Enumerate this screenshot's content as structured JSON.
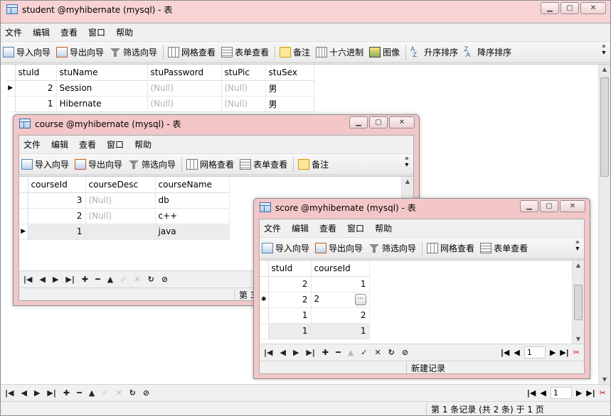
{
  "main": {
    "title": "student @myhibernate (mysql) - 表",
    "menu": [
      "文件",
      "编辑",
      "查看",
      "窗口",
      "帮助"
    ],
    "toolbar": [
      "导入向导",
      "导出向导",
      "筛选向导",
      "网格查看",
      "表单查看",
      "备注",
      "十六进制",
      "图像",
      "升序排序",
      "降序排序"
    ],
    "columns": [
      "stuId",
      "stuName",
      "stuPassword",
      "stuPic",
      "stuSex"
    ],
    "rows": [
      [
        "2",
        "Session",
        "(Null)",
        "(Null)",
        "男"
      ],
      [
        "1",
        "Hibernate",
        "(Null)",
        "(Null)",
        "男"
      ]
    ],
    "page": "1",
    "status": "第 1 条记录 (共 2 条) 于 1 页"
  },
  "course": {
    "title": "course @myhibernate (mysql) - 表",
    "menu": [
      "文件",
      "编辑",
      "查看",
      "窗口",
      "帮助"
    ],
    "toolbar": [
      "导入向导",
      "导出向导",
      "筛选向导",
      "网格查看",
      "表单查看",
      "备注"
    ],
    "columns": [
      "courseId",
      "courseDesc",
      "courseName"
    ],
    "rows": [
      [
        "3",
        "(Null)",
        "db"
      ],
      [
        "2",
        "(Null)",
        "c++"
      ],
      [
        "1",
        "",
        "java"
      ]
    ],
    "status_fragment": "第 3"
  },
  "score": {
    "title": "score @myhibernate (mysql) - 表",
    "menu": [
      "文件",
      "编辑",
      "查看",
      "窗口",
      "帮助"
    ],
    "toolbar": [
      "导入向导",
      "导出向导",
      "筛选向导",
      "网格查看",
      "表单查看"
    ],
    "columns": [
      "stuId",
      "courseId"
    ],
    "rows": [
      [
        "2",
        "1"
      ],
      [
        "2",
        "2"
      ],
      [
        "1",
        "2"
      ],
      [
        "1",
        "1"
      ]
    ],
    "page": "1",
    "status": "新建记录"
  },
  "icons": {
    "nav": [
      "first",
      "prev",
      "next",
      "last",
      "add",
      "delete",
      "up",
      "check",
      "cancel",
      "refresh",
      "stop"
    ]
  }
}
